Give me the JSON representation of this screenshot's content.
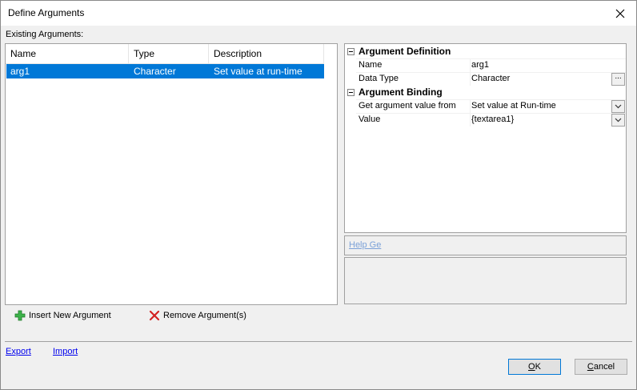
{
  "window": {
    "title": "Define Arguments"
  },
  "existing_label": "Existing Arguments:",
  "columns": [
    "Name",
    "Type",
    "Description"
  ],
  "rows": [
    {
      "name": "arg1",
      "type": "Character",
      "description": "Set value at run-time",
      "selected": true
    }
  ],
  "actions": {
    "insert": "Insert New Argument",
    "remove": "Remove Argument(s)"
  },
  "property_grid": {
    "categories": [
      {
        "label": "Argument Definition",
        "rows": [
          {
            "name": "Name",
            "value": "arg1",
            "button": ""
          },
          {
            "name": "Data Type",
            "value": "Character",
            "button": "..."
          }
        ]
      },
      {
        "label": "Argument Binding",
        "rows": [
          {
            "name": "Get argument value from",
            "value": "Set value at Run-time",
            "button": "dropdown"
          },
          {
            "name": "Value",
            "value": "{textarea1}",
            "button": "dropdown"
          }
        ]
      }
    ]
  },
  "help_link": "Help Ge",
  "footer": {
    "export": "Export",
    "import": "Import",
    "ok_mnemonic": "O",
    "ok_rest": "K",
    "cancel_mnemonic": "C",
    "cancel_rest": "ancel"
  },
  "colors": {
    "selection": "#0078d7",
    "help_link": "#7ba1d8",
    "link": "#0000ee"
  }
}
